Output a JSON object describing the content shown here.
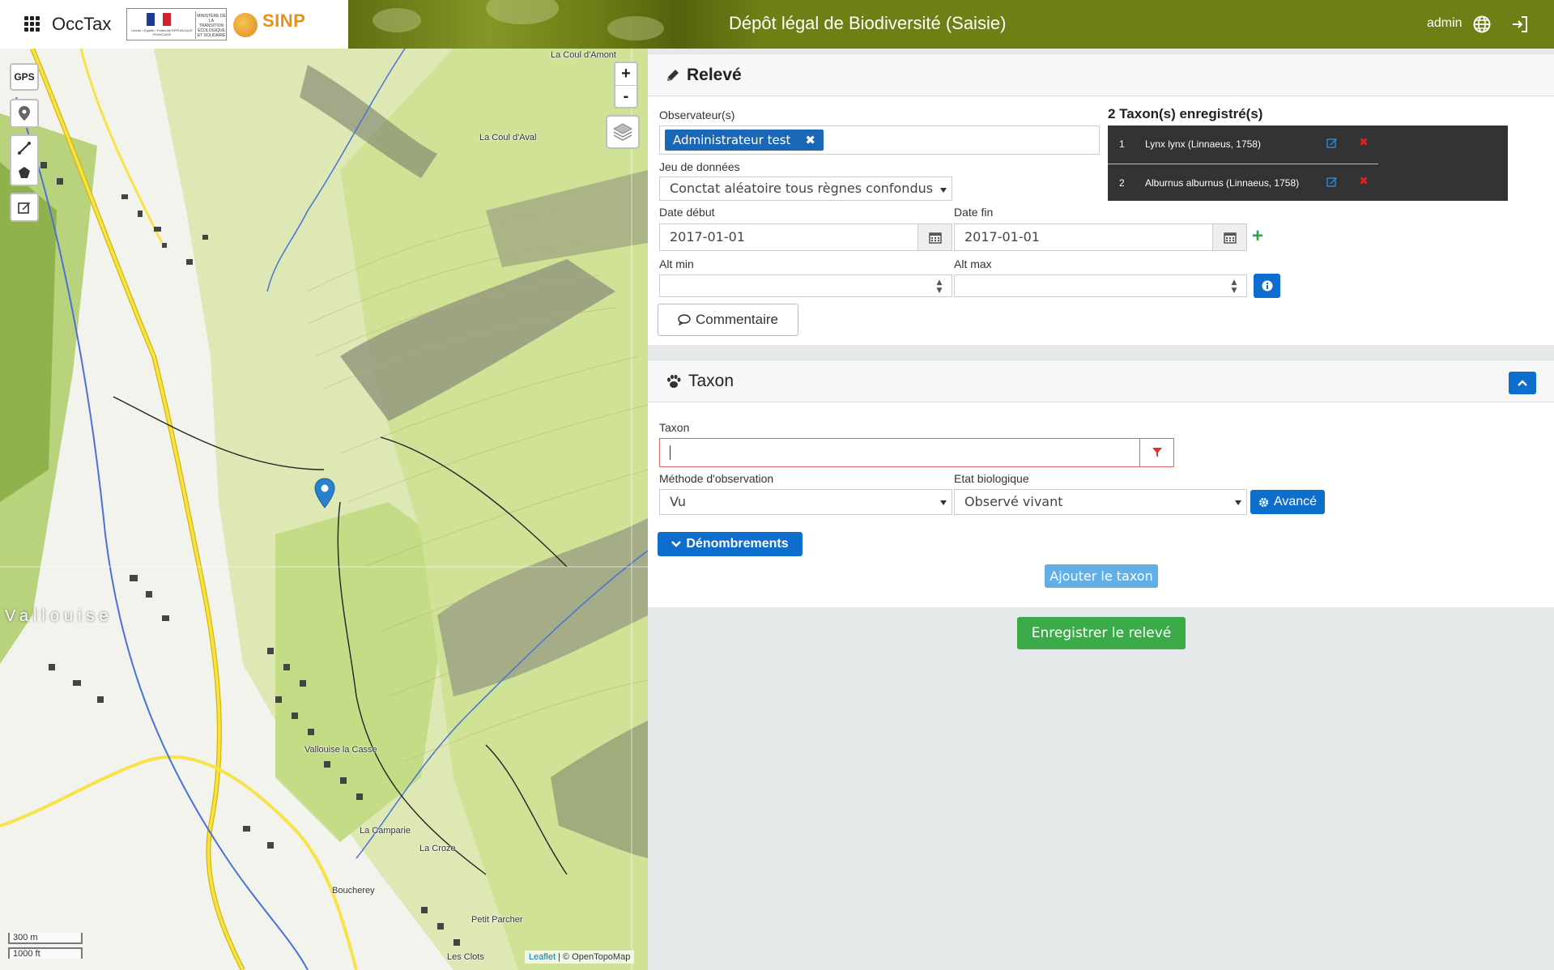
{
  "header": {
    "brand": "OccTax",
    "title": "Dépôt légal de Biodiversité (Saisie)",
    "user": "admin",
    "logo_ministere": "MINISTÈRE DE LA TRANSITION ÉCOLOGIQUE ET SOLIDAIRE",
    "logo_republique": "Liberté • Égalité • Fraternité RÉPUBLIQUE FRANÇAISE",
    "logo_sinp": "SINP"
  },
  "map": {
    "gps_label": "GPS",
    "zoom_in": "+",
    "zoom_out": "-",
    "scale_m": "300 m",
    "scale_ft": "1000 ft",
    "attribution_link": "Leaflet",
    "attribution_text": " | © OpenTopoMap",
    "place_labels": {
      "coul_amont": "La Coul d'Amont",
      "coul_aval": "La Coul d'Aval",
      "vallouise": "Vallouise",
      "vallouise_casse": "Vallouise la Casse",
      "la_camparie": "La Camparie",
      "la_croze": "La Croze",
      "boucherey": "Boucherey",
      "petit_parcher": "Petit Parcher",
      "les_clots": "Les Clots"
    }
  },
  "releve": {
    "title": "Relevé",
    "observers_label": "Observateur(s)",
    "observer_chip": "Administrateur test",
    "dataset_label": "Jeu de données",
    "dataset_value": "Conctat aléatoire tous règnes confondus",
    "date_start_label": "Date début",
    "date_start": "2017-01-01",
    "date_end_label": "Date fin",
    "date_end": "2017-01-01",
    "alt_min_label": "Alt min",
    "alt_max_label": "Alt max",
    "comment_button": "Commentaire",
    "taxa_title": "2 Taxon(s) enregistré(s)",
    "taxa": [
      {
        "num": "1",
        "name": "Lynx lynx (Linnaeus, 1758)"
      },
      {
        "num": "2",
        "name": "Alburnus alburnus (Linnaeus, 1758)"
      }
    ]
  },
  "taxon": {
    "title": "Taxon",
    "taxon_label": "Taxon",
    "taxon_value": "",
    "method_label": "Méthode d'observation",
    "method_value": "Vu",
    "state_label": "Etat biologique",
    "state_value": "Observé vivant",
    "advanced_button": "Avancé",
    "counting_button": "Dénombrements",
    "add_button": "Ajouter le taxon"
  },
  "save_button": "Enregistrer le relevé",
  "colors": {
    "topbar": "#6f7e15",
    "primary": "#0d6ecd",
    "success": "#3bab4a",
    "danger": "#e02020"
  }
}
